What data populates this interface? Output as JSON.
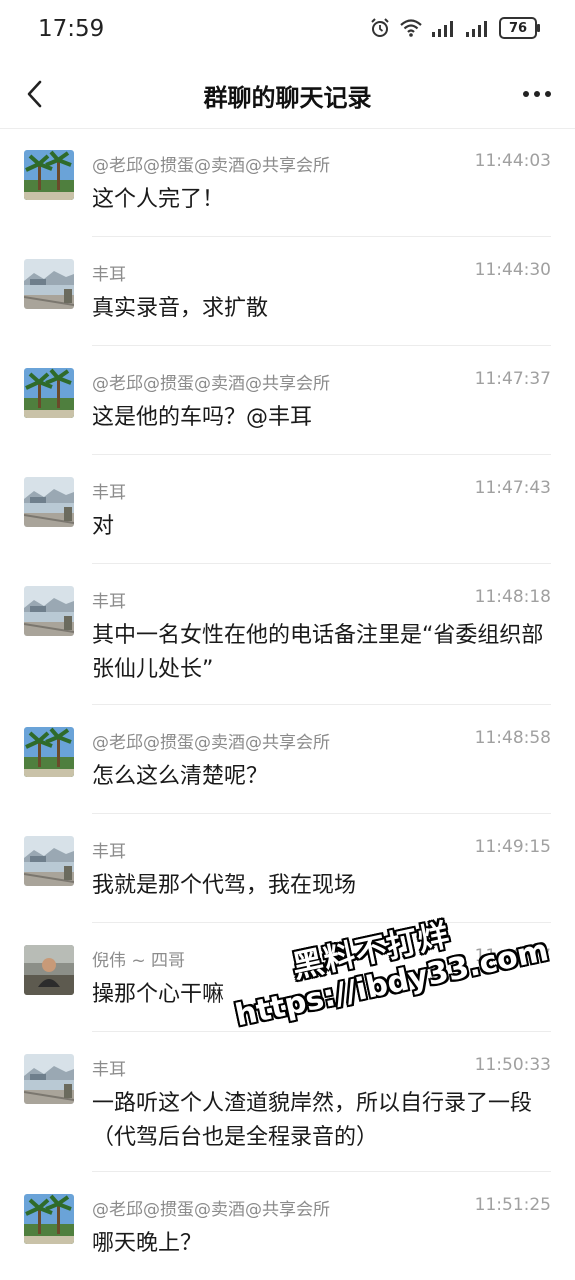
{
  "status_bar": {
    "time": "17:59",
    "battery": "76"
  },
  "header": {
    "title": "群聊的聊天记录"
  },
  "messages": [
    {
      "sender": "@老邱@掼蛋@卖酒@共享会所",
      "time": "11:44:03",
      "text": "这个人完了！",
      "avatar": "palm"
    },
    {
      "sender": "丰耳",
      "time": "11:44:30",
      "text": "真实录音，求扩散",
      "avatar": "harbor"
    },
    {
      "sender": "@老邱@掼蛋@卖酒@共享会所",
      "time": "11:47:37",
      "text": "这是他的车吗？@丰耳",
      "avatar": "palm"
    },
    {
      "sender": "丰耳",
      "time": "11:47:43",
      "text": "对",
      "avatar": "harbor"
    },
    {
      "sender": "丰耳",
      "time": "11:48:18",
      "text": "其中一名女性在他的电话备注里是“省委组织部张仙儿处长”",
      "avatar": "harbor"
    },
    {
      "sender": "@老邱@掼蛋@卖酒@共享会所",
      "time": "11:48:58",
      "text": "怎么这么清楚呢？",
      "avatar": "palm"
    },
    {
      "sender": "丰耳",
      "time": "11:49:15",
      "text": "我就是那个代驾，我在现场",
      "avatar": "harbor"
    },
    {
      "sender": "倪伟 ~ 四哥",
      "time": "11:49:27",
      "text": "操那个心干嘛",
      "avatar": "person"
    },
    {
      "sender": "丰耳",
      "time": "11:50:33",
      "text": "一路听这个人渣道貌岸然，所以自行录了一段（代驾后台也是全程录音的）",
      "avatar": "harbor"
    },
    {
      "sender": "@老邱@掼蛋@卖酒@共享会所",
      "time": "11:51:25",
      "text": "哪天晚上？",
      "avatar": "palm"
    }
  ],
  "watermark": {
    "line1": "黑料不打烊",
    "line2": "https://ibdy33.com"
  },
  "colors": {
    "meta_text": "#a0a0a0",
    "divider": "#ececec",
    "message_text": "#1a1a1a"
  }
}
